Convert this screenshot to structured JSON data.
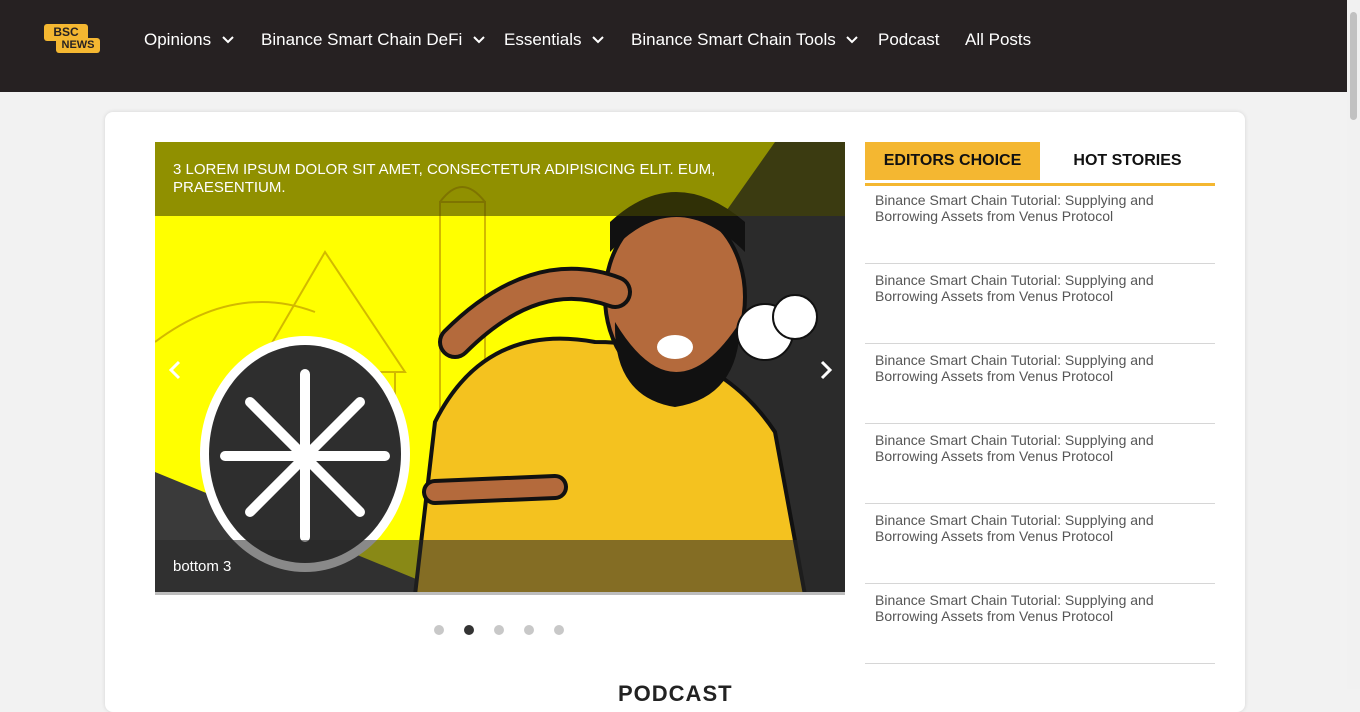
{
  "header": {
    "logo": {
      "top": "BSC",
      "bottom": "NEWS"
    },
    "nav": [
      {
        "label": "Opinions",
        "has_dropdown": true
      },
      {
        "label": "Binance Smart Chain DeFi",
        "has_dropdown": true
      },
      {
        "label": "Essentials",
        "has_dropdown": true
      },
      {
        "label": "Binance Smart Chain Tools",
        "has_dropdown": true
      },
      {
        "label": "Podcast",
        "has_dropdown": false
      },
      {
        "label": "All Posts",
        "has_dropdown": false
      }
    ]
  },
  "slider": {
    "title": "3 LOREM IPSUM DOLOR SIT AMET, CONSECTETUR ADIPISICING ELIT. EUM, PRAESENTIUM.",
    "caption": "bottom 3",
    "dots_count": 5,
    "active_dot": 2
  },
  "section_heading": "PODCAST",
  "sidebar": {
    "tabs": [
      "EDITORS CHOICE",
      "HOT STORIES"
    ],
    "active_tab": "EDITORS CHOICE",
    "stories": [
      "Binance Smart Chain Tutorial: Supplying and Borrowing Assets from Venus Protocol",
      "Binance Smart Chain Tutorial: Supplying and Borrowing Assets from Venus Protocol",
      "Binance Smart Chain Tutorial: Supplying and Borrowing Assets from Venus Protocol",
      "Binance Smart Chain Tutorial: Supplying and Borrowing Assets from Venus Protocol",
      "Binance Smart Chain Tutorial: Supplying and Borrowing Assets from Venus Protocol",
      "Binance Smart Chain Tutorial: Supplying and Borrowing Assets from Venus Protocol"
    ]
  },
  "colors": {
    "nav_bg": "#262122",
    "accent": "#f4b731",
    "slide_bg": "#ffff00"
  }
}
